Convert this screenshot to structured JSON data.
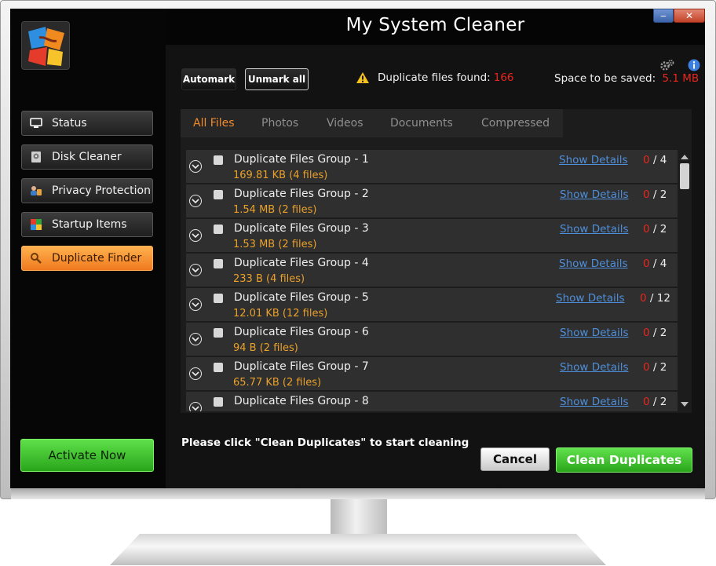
{
  "app": {
    "title": "My System Cleaner"
  },
  "window_controls": {
    "minimize": "‒",
    "close": "✕"
  },
  "sidebar": {
    "items": [
      {
        "label": "Status",
        "icon": "monitor-icon",
        "active": false
      },
      {
        "label": "Disk Cleaner",
        "icon": "disk-icon",
        "active": false
      },
      {
        "label": "Privacy Protection",
        "icon": "privacy-icon",
        "active": false
      },
      {
        "label": "Startup Items",
        "icon": "startup-icon",
        "active": false
      },
      {
        "label": "Duplicate Finder",
        "icon": "search-icon",
        "active": true
      }
    ],
    "activate_label": "Activate Now"
  },
  "toolbar": {
    "automark_label": "Automark",
    "unmark_label": "Unmark all",
    "found_label": "Duplicate files found:",
    "found_value": "166",
    "saved_label": "Space to be saved:",
    "saved_value": "5.1 MB"
  },
  "tabs": [
    "All Files",
    "Photos",
    "Videos",
    "Documents",
    "Compressed"
  ],
  "active_tab": "All Files",
  "groups": [
    {
      "name": "Duplicate Files Group - 1",
      "info": "169.81 KB  (4 files)",
      "details": "Show Details",
      "selected": "0",
      "total": "4"
    },
    {
      "name": "Duplicate Files Group - 2",
      "info": "1.54 MB  (2 files)",
      "details": "Show Details",
      "selected": "0",
      "total": "2"
    },
    {
      "name": "Duplicate Files Group - 3",
      "info": "1.53 MB  (2 files)",
      "details": "Show Details",
      "selected": "0",
      "total": "2"
    },
    {
      "name": "Duplicate Files Group - 4",
      "info": "233 B  (4 files)",
      "details": "Show Details",
      "selected": "0",
      "total": "4"
    },
    {
      "name": "Duplicate Files Group - 5",
      "info": "12.01 KB  (12 files)",
      "details": "Show Details",
      "selected": "0",
      "total": "12"
    },
    {
      "name": "Duplicate Files Group - 6",
      "info": "94 B  (2 files)",
      "details": "Show Details",
      "selected": "0",
      "total": "2"
    },
    {
      "name": "Duplicate Files Group - 7",
      "info": "65.77 KB  (2 files)",
      "details": "Show Details",
      "selected": "0",
      "total": "2"
    },
    {
      "name": "Duplicate Files Group - 8",
      "info": "",
      "details": "Show Details",
      "selected": "0",
      "total": "2"
    }
  ],
  "footer": {
    "hint": "Please click \"Clean Duplicates\" to start cleaning",
    "cancel_label": "Cancel",
    "clean_label": "Clean Duplicates"
  },
  "colors": {
    "accent_orange": "#f28a2e",
    "green": "#2aa51b",
    "count_red": "#e8271e",
    "info_orange": "#eaa12a",
    "link_blue": "#4f8fda"
  }
}
